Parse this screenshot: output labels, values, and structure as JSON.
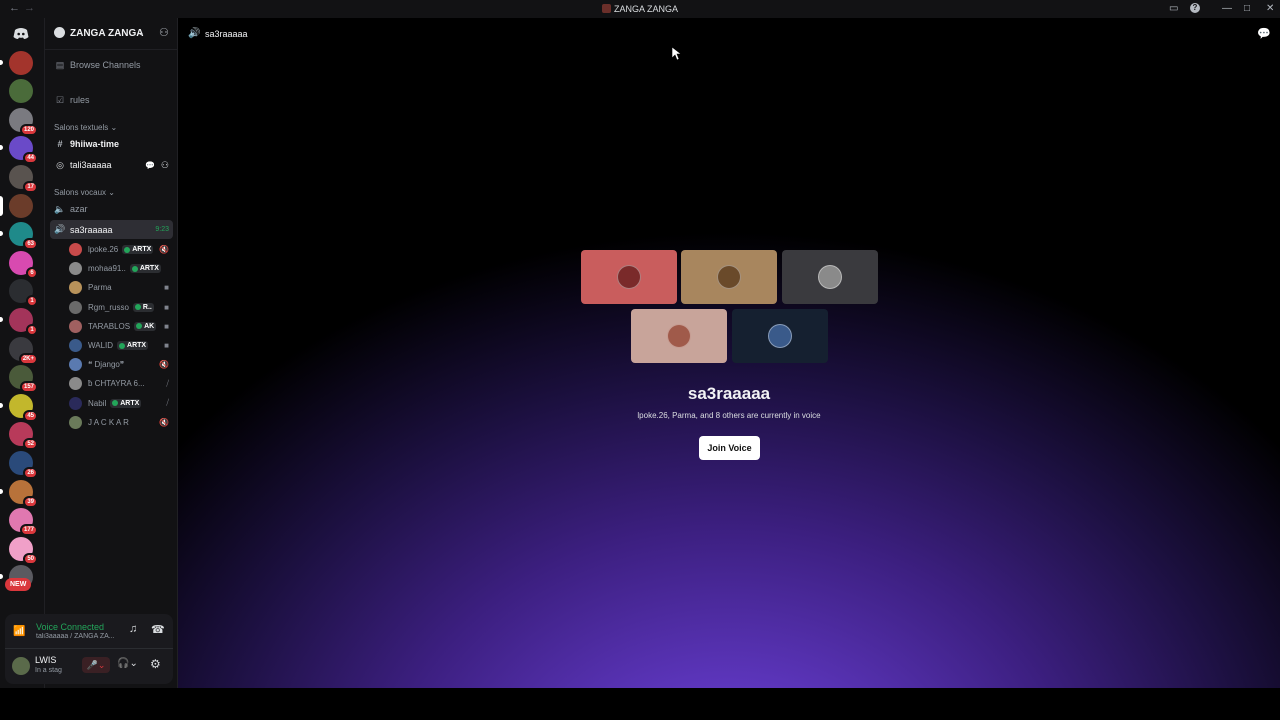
{
  "window": {
    "title": "ZANGA ZANGA",
    "back": "←",
    "forward": "→",
    "buttons": {
      "inbox": "▭",
      "help": "?",
      "minimize": "—",
      "maximize": "□",
      "close": "✕"
    }
  },
  "guilds": [
    {
      "color": "#5865f2",
      "icon": "discord-icon"
    },
    {
      "color": "#a3342c",
      "badge": ""
    },
    {
      "color": "#4a6b3a"
    },
    {
      "color": "#7a7a80",
      "badge": "120"
    },
    {
      "color": "#6a4ac8",
      "badge": "44"
    },
    {
      "color": "#59534f",
      "badge": "17"
    },
    {
      "color": "#6b3c2a",
      "selected": true
    },
    {
      "color": "#1f8a8a",
      "badge": "63"
    },
    {
      "color": "#d84ab0",
      "badge": "6"
    },
    {
      "color": "#2b2d31",
      "badge": "1"
    },
    {
      "color": "#a3345a",
      "badge": "1"
    },
    {
      "color": "#3a3a3f",
      "badge": "2K+"
    },
    {
      "color": "#4a5a3a",
      "badge": "157"
    },
    {
      "color": "#c2b72c",
      "badge": "45"
    },
    {
      "color": "#b83a5a",
      "badge": "52"
    },
    {
      "color": "#2a4a7a",
      "badge": "26"
    },
    {
      "color": "#b8723a",
      "badge": "39"
    },
    {
      "color": "#e078b0",
      "badge": "177"
    },
    {
      "color": "#f0a0c8",
      "badge": "50"
    },
    {
      "color": "#5a5a60"
    }
  ],
  "new_badge": "NEW",
  "server": {
    "name": "ZANGA ZANGA",
    "browse_channels": "Browse Channels",
    "rules": "rules",
    "text_category": "Salons textuels",
    "text_channels": [
      {
        "name": "9hiiwa-time",
        "unread": true
      },
      {
        "name": "tali3aaaaa",
        "unread": true
      }
    ],
    "voice_category": "Salons vocaux",
    "voice_channels": [
      {
        "name": "azar"
      },
      {
        "name": "sa3raaaaa",
        "timer": "9:23",
        "active": true
      }
    ],
    "members": [
      {
        "name": "lpoke.26",
        "tag": "ARTX",
        "color": "#c84a4a",
        "icon": "🔇"
      },
      {
        "name": "mohaa91..",
        "tag": "ARTX",
        "color": "#8a8a8a",
        "icon": ""
      },
      {
        "name": "Parma",
        "tag": "",
        "color": "#b8925a",
        "icon": "■"
      },
      {
        "name": "Rgm_russo",
        "tag": "R..",
        "color": "#6a6a6a",
        "icon": "■"
      },
      {
        "name": "TARABLOS",
        "tag": "AK",
        "color": "#a06060",
        "icon": "■"
      },
      {
        "name": "WALID",
        "tag": "ARTX",
        "color": "#3a5a8a",
        "icon": "■"
      },
      {
        "name": "❝ Django❞",
        "tag": "",
        "color": "#5a7ab0",
        "icon": "🔇"
      },
      {
        "name": "ƀ CHTAYRA 6...",
        "tag": "",
        "color": "#8a8a8a",
        "icon": "⧸"
      },
      {
        "name": "Nabil",
        "tag": "ARTX",
        "color": "#2a2a5a",
        "icon": "⧸"
      },
      {
        "name": "J A C K A R",
        "tag": "",
        "color": "#6a7a5a",
        "icon": "🔇"
      }
    ]
  },
  "voice_panel": {
    "status": "Voice Connected",
    "location": "tali3aaaaa / ZANGA ZA...",
    "user": "LWIS",
    "user_status": "In a stag"
  },
  "main": {
    "channel_name": "sa3raaaaa",
    "tiles": [
      {
        "bg": "#c95d5d",
        "face": "#7a2a2a"
      },
      {
        "bg": "#a8865e",
        "face": "#6a4a2a"
      },
      {
        "bg": "#3a3a3e",
        "face": "#8a8a8a"
      },
      {
        "bg": "#c8a49a",
        "face": "#a05a4a"
      },
      {
        "bg": "#152030",
        "face": "#3a5a8a"
      }
    ],
    "title": "sa3raaaaa",
    "subtitle": "lpoke.26, Parma, and 8 others are currently in voice",
    "join_label": "Join Voice"
  },
  "colors": {
    "green": "#23a55a",
    "red": "#da373c",
    "white": "#ffffff"
  }
}
